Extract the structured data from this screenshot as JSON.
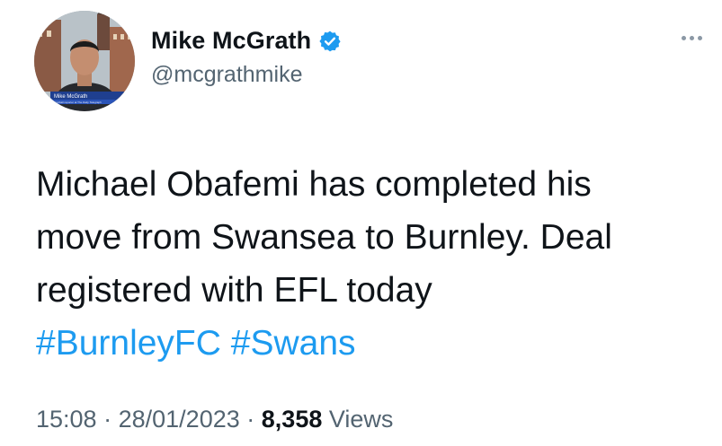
{
  "author": {
    "display_name": "Mike McGrath",
    "handle": "@mcgrathmike",
    "verified": true,
    "avatar_caption": "Mike McGrath",
    "avatar_subcaption": "Football reporter at The Daily Telegraph"
  },
  "tweet": {
    "text_lines": [
      "Michael Obafemi has completed his",
      "move from Swansea to Burnley. Deal",
      "registered with EFL today"
    ],
    "hashtags": [
      "#BurnleyFC",
      "#Swans"
    ]
  },
  "meta": {
    "time": "15:08",
    "separator": "·",
    "date": "28/01/2023",
    "views_count": "8,358",
    "views_label": "Views"
  },
  "icons": {
    "verified": "verified-badge-icon",
    "more": "more-options-icon"
  },
  "colors": {
    "link": "#1d9bf0",
    "verified": "#1d9bf0",
    "secondary_text": "#536471",
    "primary_text": "#0f1419"
  }
}
